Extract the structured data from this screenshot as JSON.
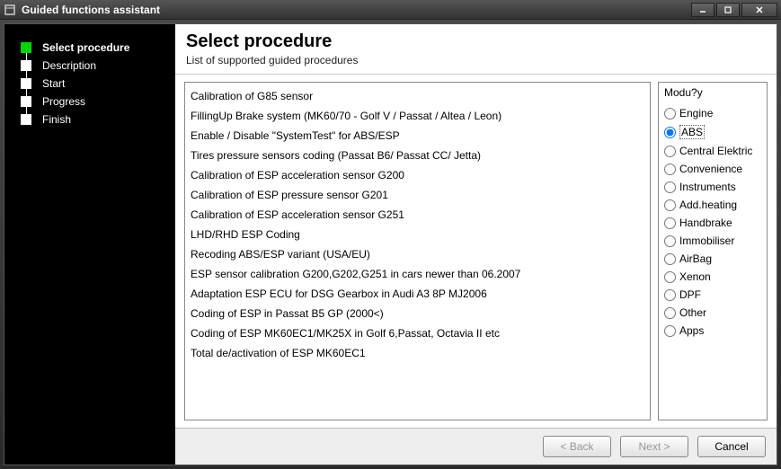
{
  "window": {
    "title": "Guided functions assistant"
  },
  "sidebar": {
    "steps": [
      {
        "label": "Select procedure",
        "active": true
      },
      {
        "label": "Description",
        "active": false
      },
      {
        "label": "Start",
        "active": false
      },
      {
        "label": "Progress",
        "active": false
      },
      {
        "label": "Finish",
        "active": false
      }
    ]
  },
  "main": {
    "title": "Select procedure",
    "subtitle": "List of supported guided procedures",
    "procedures": [
      "Calibration of G85 sensor",
      "FillingUp Brake system (MK60/70 - Golf V / Passat / Altea / Leon)",
      "Enable / Disable \"SystemTest\" for ABS/ESP",
      "Tires pressure sensors coding (Passat B6/ Passat CC/ Jetta)",
      "Calibration of ESP acceleration sensor G200",
      "Calibration of ESP pressure sensor G201",
      "Calibration of ESP acceleration sensor G251",
      "LHD/RHD ESP Coding",
      "Recoding ABS/ESP variant (USA/EU)",
      "ESP sensor calibration G200,G202,G251 in cars newer than 06.2007",
      "Adaptation ESP ECU for DSG Gearbox in Audi A3 8P MJ2006",
      "Coding of ESP in Passat B5 GP (2000<)",
      "Coding of ESP MK60EC1/MK25X in Golf 6,Passat, Octavia II etc",
      "Total de/activation of ESP MK60EC1"
    ],
    "modules": {
      "group_label": "Modu?y",
      "selected": "ABS",
      "items": [
        "Engine",
        "ABS",
        "Central Elektric",
        "Convenience",
        "Instruments",
        "Add.heating",
        "Handbrake",
        "Immobiliser",
        "AirBag",
        "Xenon",
        "DPF",
        "Other",
        "Apps"
      ]
    }
  },
  "footer": {
    "back": "< Back",
    "next": "Next >",
    "cancel": "Cancel"
  }
}
